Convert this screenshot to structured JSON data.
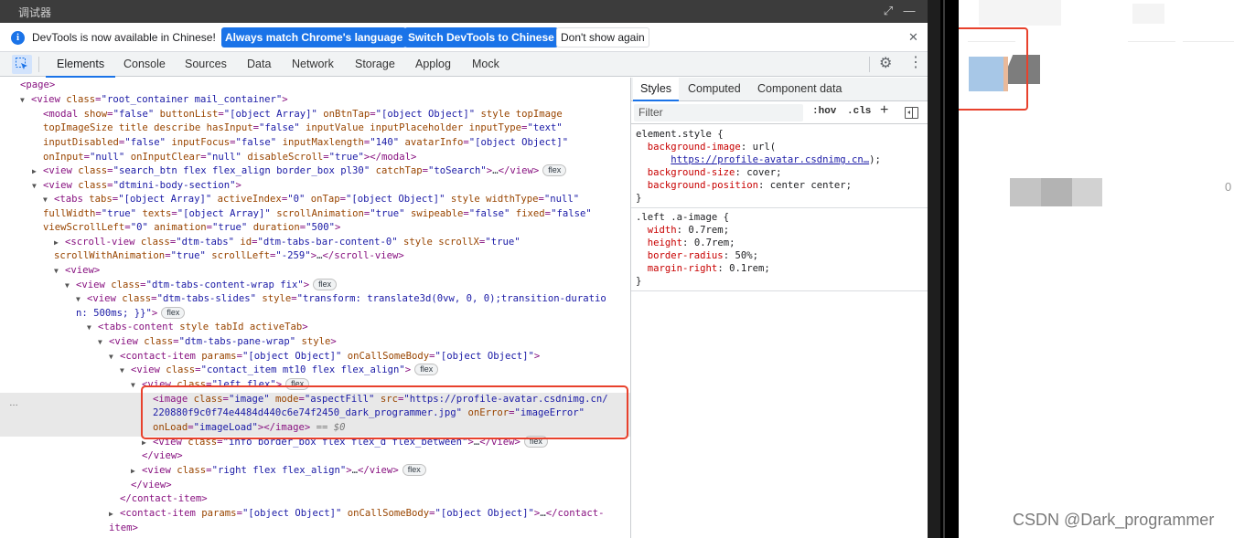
{
  "window": {
    "title": "调试器",
    "expand_glyph": "⤢",
    "minimize_glyph": "—"
  },
  "infobar": {
    "icon_glyph": "i",
    "message": "DevTools is now available in Chinese!",
    "btn_match": "Always match Chrome's language",
    "btn_switch": "Switch DevTools to Chinese",
    "btn_dont_show": "Don't show again",
    "close_glyph": "✕"
  },
  "tabs": [
    "Elements",
    "Console",
    "Sources",
    "Data",
    "Network",
    "Storage",
    "Applog",
    "Mock"
  ],
  "active_tab": "Elements",
  "toolbar": {
    "settings_glyph": "⚙",
    "more_glyph": "⋮"
  },
  "dom_tree": {
    "selected_suffix": "== $0",
    "dots": "…"
  },
  "styles_panel": {
    "tabs": [
      "Styles",
      "Computed",
      "Component data"
    ],
    "filter_placeholder": "Filter",
    "hov": ":hov",
    "cls": ".cls",
    "plus": "+",
    "element_style": {
      "selector": "element.style {",
      "bg_image_prop": "background-image",
      "bg_image_val": "url(",
      "bg_image_link": "https://profile-avatar.csdnimg.cn…",
      "bg_image_end": ");",
      "bg_size_prop": "background-size",
      "bg_size_val": "cover;",
      "bg_pos_prop": "background-position",
      "bg_pos_val": "center center;",
      "close": "}"
    },
    "a_image": {
      "selector": ".left .a-image {",
      "width_prop": "width",
      "width_val": "0.7rem;",
      "height_prop": "height",
      "height_val": "0.7rem;",
      "radius_prop": "border-radius",
      "radius_val": "50%;",
      "margin_prop": "margin-right",
      "margin_val": "0.1rem;",
      "close": "}"
    }
  },
  "simulator": {
    "partial_number": "0",
    "watermark": "CSDN @Dark_programmer"
  },
  "colors": {
    "accent": "#1a73e8",
    "highlight_border": "#e8412c",
    "tag": "#881280",
    "attr_name": "#994500",
    "attr_value": "#1a1aa6"
  }
}
